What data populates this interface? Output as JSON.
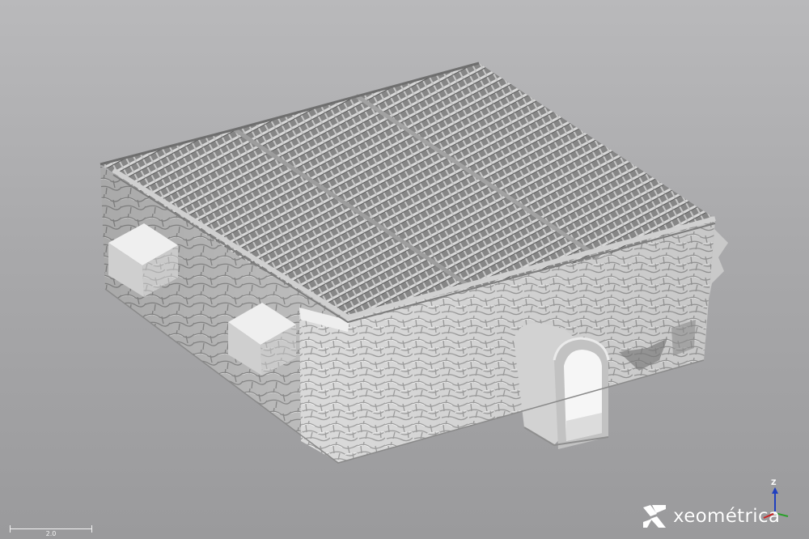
{
  "scene": {
    "subject": "3d-scan-stone-building",
    "background_top": "#b9b9bb",
    "background_bottom": "#9a9a9c",
    "surface_color": "#e0e0e0",
    "roof_color": "#8a8a8a"
  },
  "scale_bar": {
    "label": "2.0"
  },
  "axis_gizmo": {
    "z_label": "Z"
  },
  "brand": {
    "name": "xeométrica",
    "logo_icon": "xeometrica-logo-icon"
  }
}
